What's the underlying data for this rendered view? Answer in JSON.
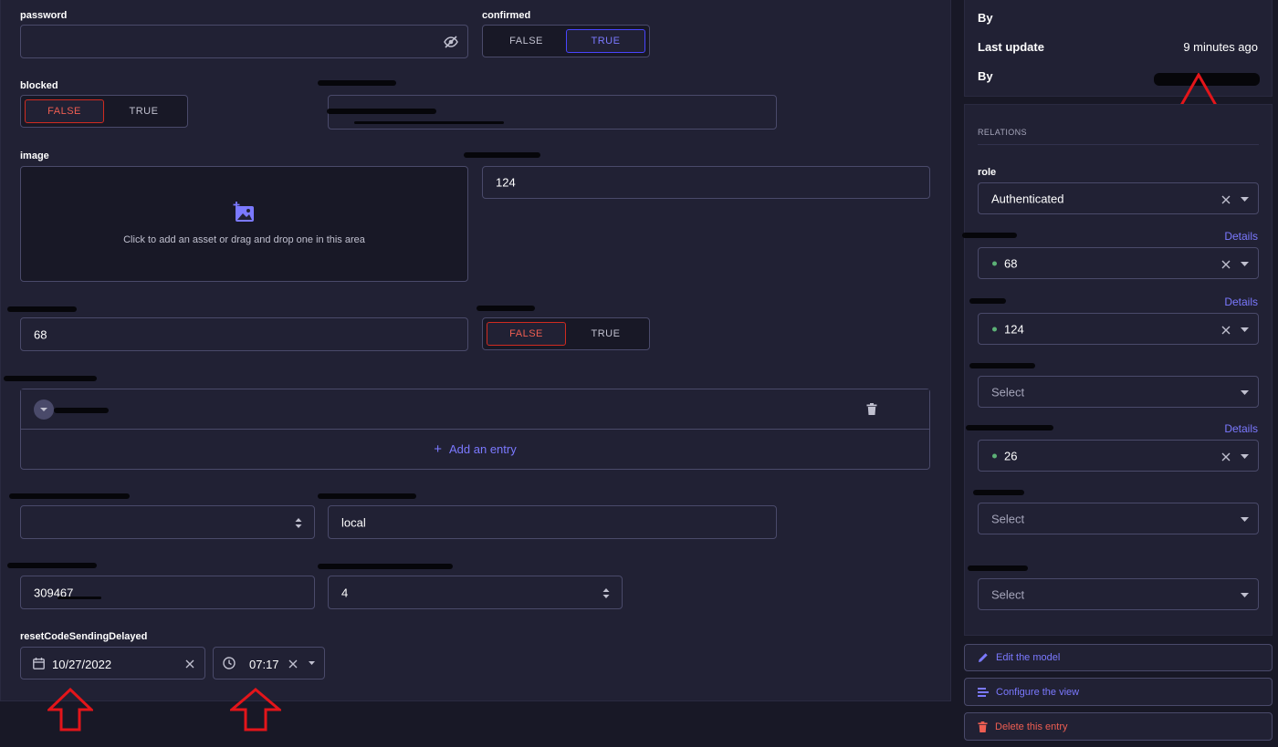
{
  "form": {
    "password_label": "password",
    "password_value": "",
    "confirmed_label": "confirmed",
    "confirmed_false": "FALSE",
    "confirmed_true": "TRUE",
    "blocked_label": "blocked",
    "blocked_false": "FALSE",
    "blocked_true": "TRUE",
    "image_label": "image",
    "image_dropzone_text": "Click to add an asset or drag and drop one in this area",
    "number_field_value": "124",
    "second_field_value": "68",
    "toggle2_false": "FALSE",
    "toggle2_true": "TRUE",
    "add_entry_label": "Add an entry",
    "provider_value": "local",
    "code_value": "309467",
    "stepper_value": "4",
    "reset_label": "resetCodeSendingDelayed",
    "date_value": "10/27/2022",
    "time_value": "07:17"
  },
  "sidebar": {
    "by_label_1": "By",
    "last_update_label": "Last update",
    "last_update_value": "9 minutes ago",
    "by_label_2": "By",
    "relations_heading": "RELATIONS",
    "role_label": "role",
    "role_value": "Authenticated",
    "rel1_link": "Details",
    "rel1_value": "68",
    "rel2_link": "Details",
    "rel2_value": "124",
    "rel3_placeholder": "Select",
    "rel4_link": "Details",
    "rel4_value": "26",
    "rel5_placeholder": "Select",
    "rel6_placeholder": "Select",
    "edit_model": "Edit the model",
    "configure_view": "Configure the view",
    "delete_entry": "Delete this entry"
  },
  "colors": {
    "background": "#181826",
    "panel": "#212134",
    "border": "#4a4a6a",
    "primary": "#7b79ff",
    "danger": "#ee5e52",
    "success": "#5cb176",
    "annotation_arrow": "#e3151a"
  }
}
